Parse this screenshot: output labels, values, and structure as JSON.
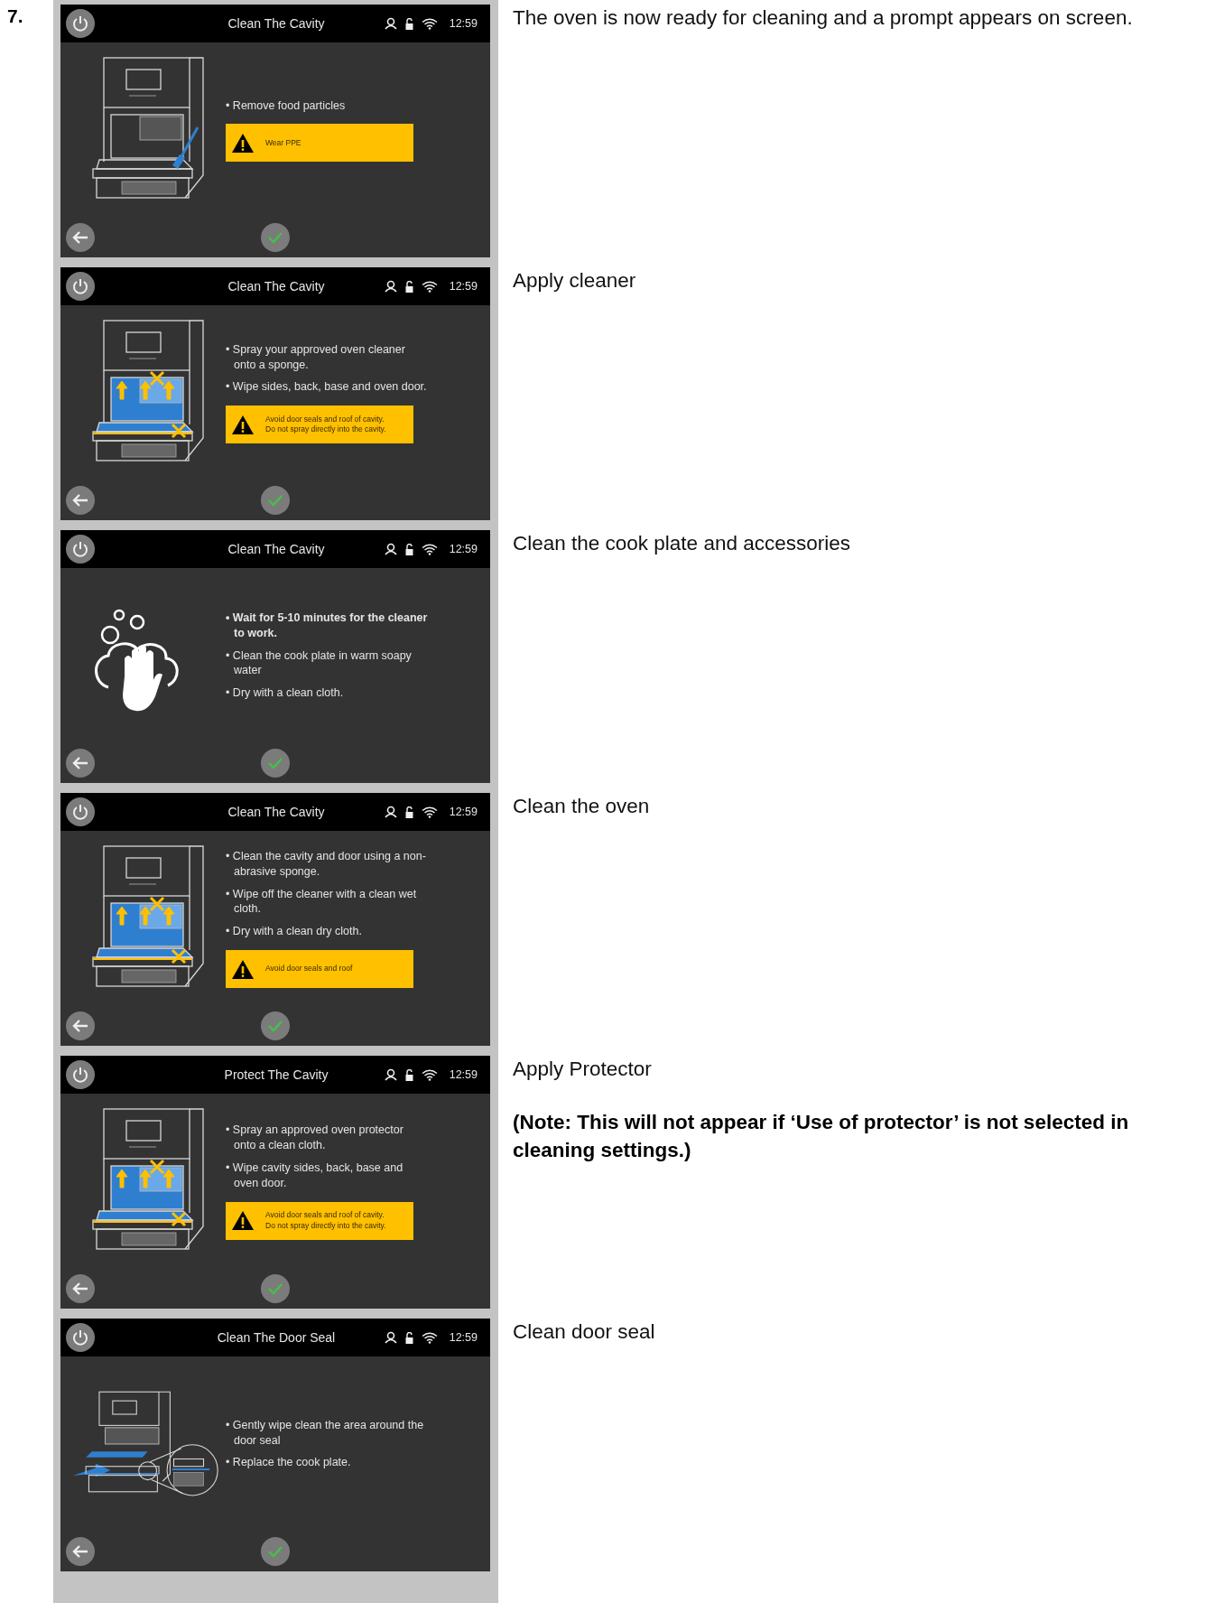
{
  "step_number": "7.",
  "steps": [
    {
      "screen": {
        "title": "Clean The Cavity",
        "time": "12:59",
        "kind": "oven_brush",
        "bullets": [
          {
            "text": "• Remove food particles",
            "bold": false
          }
        ],
        "warning": [
          "Wear PPE"
        ]
      },
      "caption": "The oven is now ready for cleaning and a prompt appears on screen."
    },
    {
      "screen": {
        "title": "Clean The Cavity",
        "time": "12:59",
        "kind": "oven_marked",
        "bullets": [
          {
            "text": "• Spray your approved oven cleaner onto a sponge.",
            "bold": false
          },
          {
            "text": "• Wipe sides, back, base and oven door.",
            "bold": false
          }
        ],
        "warning": [
          "Avoid door seals and roof of cavity.",
          "Do not spray directly into the cavity."
        ]
      },
      "caption": "Apply cleaner"
    },
    {
      "screen": {
        "title": "Clean The Cavity",
        "time": "12:59",
        "kind": "hand_wash",
        "bullets": [
          {
            "text": "• Wait for 5-10 minutes for the cleaner to work.",
            "bold": true
          },
          {
            "text": "• Clean the cook plate in warm soapy water",
            "bold": false
          },
          {
            "text": "• Dry with a clean cloth.",
            "bold": false
          }
        ]
      },
      "caption": "Clean the cook plate and accessories"
    },
    {
      "screen": {
        "title": "Clean The Cavity",
        "time": "12:59",
        "kind": "oven_marked",
        "bullets": [
          {
            "text": "• Clean the cavity and door using a non-abrasive sponge.",
            "bold": false
          },
          {
            "text": "• Wipe off the cleaner with a clean wet cloth.",
            "bold": false
          },
          {
            "text": "• Dry with a clean dry cloth.",
            "bold": false
          }
        ],
        "warning": [
          "Avoid door seals and roof"
        ]
      },
      "caption": "Clean the oven"
    },
    {
      "screen": {
        "title": "Protect The Cavity",
        "time": "12:59",
        "kind": "oven_marked",
        "bullets": [
          {
            "text": "• Spray an approved oven protector onto a clean cloth.",
            "bold": false
          },
          {
            "text": "• Wipe cavity sides, back, base and oven door.",
            "bold": false
          }
        ],
        "warning": [
          "Avoid door seals and roof of cavity.",
          "Do not spray directly into the cavity."
        ]
      },
      "caption": "Apply Protector",
      "note": "(Note: This will not appear if ‘Use of protector’ is not selected in cleaning settings.)"
    },
    {
      "screen": {
        "title": "Clean The Door Seal",
        "time": "12:59",
        "kind": "door_seal",
        "bullets": [
          {
            "text": "• Gently wipe clean the area around the door seal",
            "bold": false
          },
          {
            "text": "• Replace the cook plate.",
            "bold": false
          }
        ]
      },
      "caption": "Clean door seal"
    }
  ]
}
